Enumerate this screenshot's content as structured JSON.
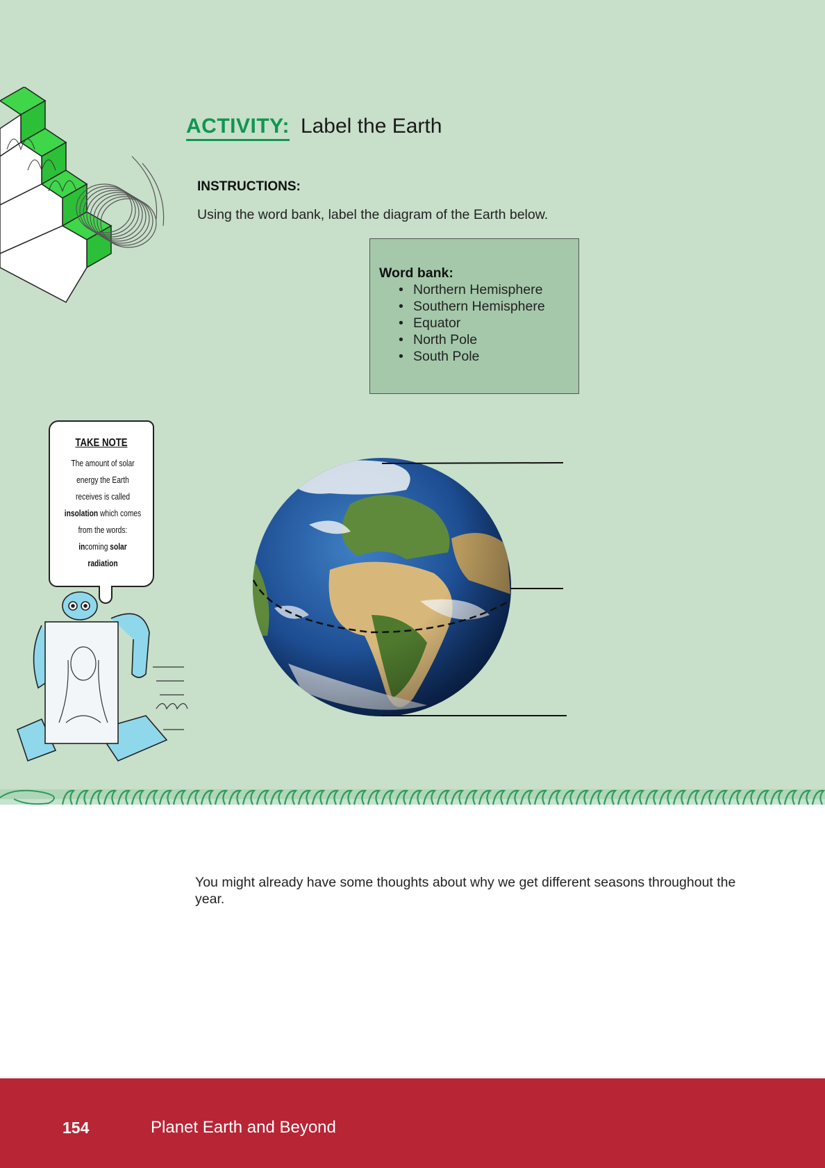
{
  "activity": {
    "label": "ACTIVITY:",
    "title": "Label the Earth"
  },
  "instructions": {
    "label": "INSTRUCTIONS:",
    "text": "Using the word bank, label the diagram of the Earth below."
  },
  "word_bank": {
    "title": "Word bank:",
    "items": [
      "Northern Hemisphere",
      "Southern Hemisphere",
      "Equator",
      "North Pole",
      "South Pole"
    ]
  },
  "take_note": {
    "title": "TAKE NOTE",
    "line1": "The amount of solar",
    "line2": "energy the Earth",
    "line3": "receives is called",
    "term": "insolation",
    "line4_rest": " which comes",
    "line5": "from the words:",
    "in_bold": "in",
    "in_rest": "coming ",
    "solar": "solar",
    "radiation": "radiation"
  },
  "body": {
    "paragraph": "You might already have some thoughts about why we get different seasons throughout the year."
  },
  "footer": {
    "page_number": "154",
    "book_title": "Planet Earth and Beyond"
  },
  "colors": {
    "page_green": "#c8dfca",
    "accent_green": "#0f9650",
    "word_bank_bg": "#a5c8ab",
    "footer_red": "#b82535"
  }
}
